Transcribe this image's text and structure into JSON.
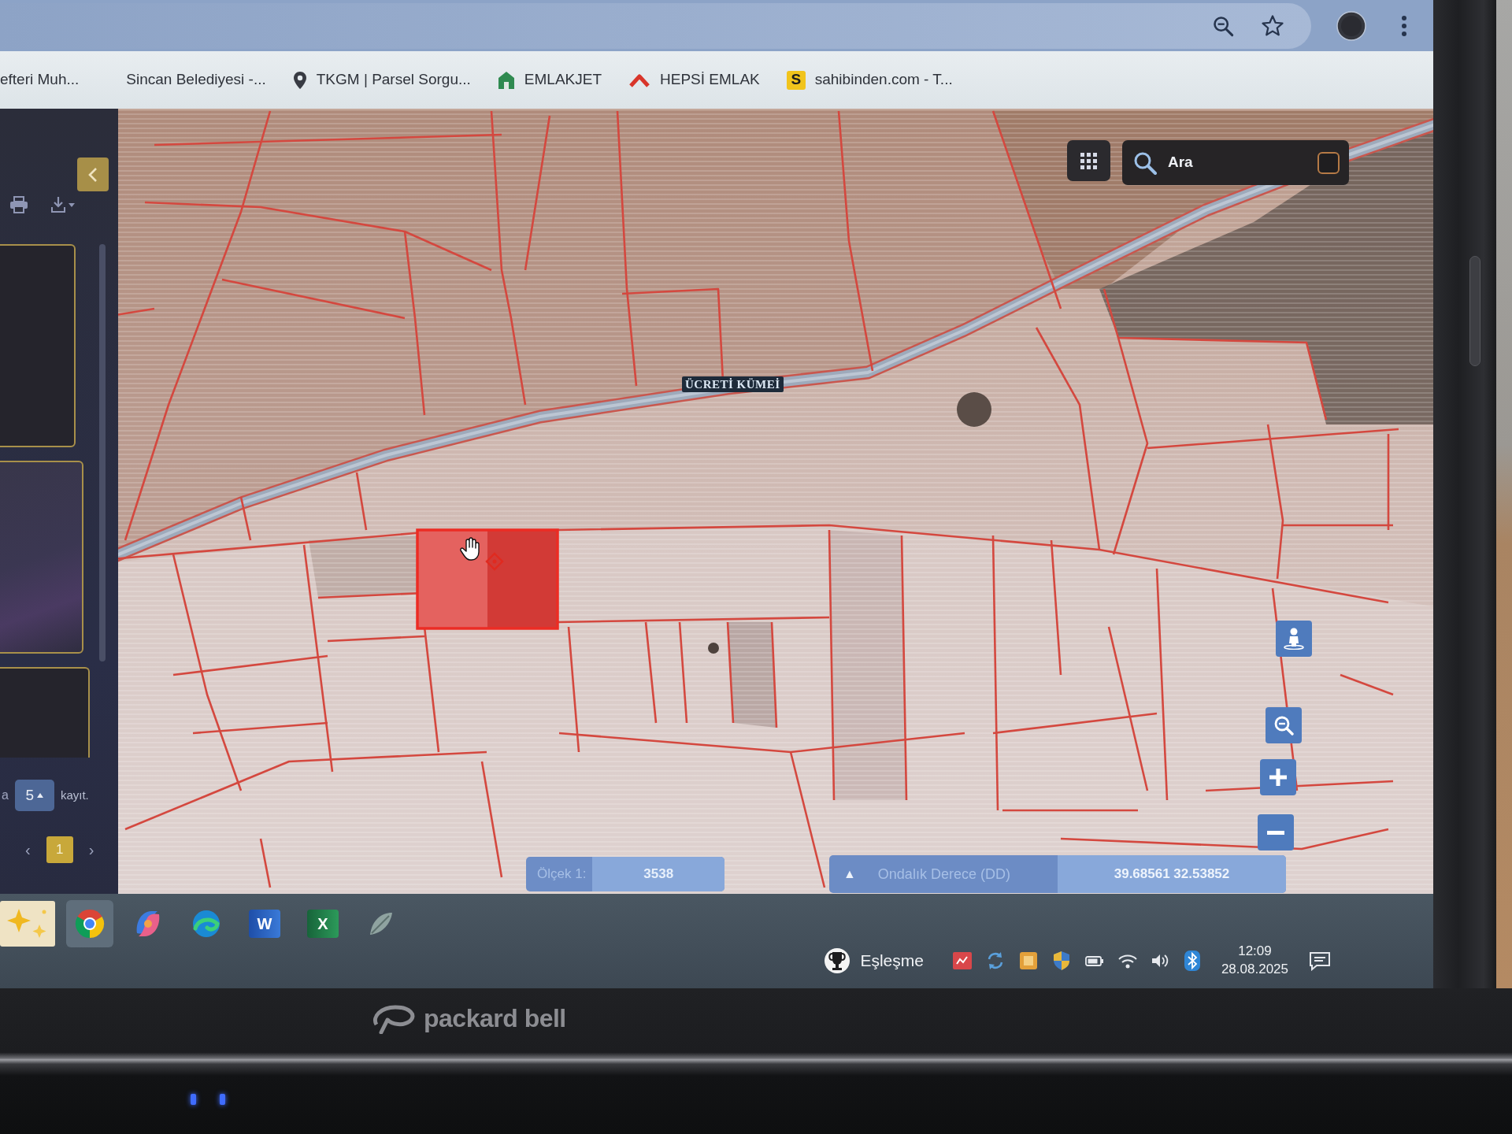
{
  "browser": {
    "bookmarks": [
      {
        "label": "efteri Muh...",
        "kind": "plain"
      },
      {
        "label": "Sincan Belediyesi -...",
        "kind": "plain"
      },
      {
        "label": "TKGM | Parsel Sorgu...",
        "kind": "pin"
      },
      {
        "label": "EMLAKJET",
        "kind": "house"
      },
      {
        "label": "HEPSİ EMLAK",
        "kind": "roof"
      },
      {
        "label": "sahibinden.com - T...",
        "kind": "letter",
        "icon_text": "S"
      }
    ]
  },
  "left_panel": {
    "cards": [
      {
        "kind": "dark"
      },
      {
        "kind": "image"
      },
      {
        "kind": "dark"
      }
    ],
    "page_size_prefix": "a",
    "page_size": "5",
    "page_size_suffix": "kayıt.",
    "prev": "‹",
    "pages": [
      {
        "label": "1",
        "selected": true
      }
    ],
    "next": "›"
  },
  "map": {
    "road_label": "ÜCRETİ KÜMEİ",
    "parcel_selected": true,
    "search": {
      "placeholder": "Ara"
    },
    "scale": {
      "label": "Ölçek 1:",
      "value": "3538"
    },
    "coordinates": {
      "toggle": "▲",
      "system": "Ondalık Derece (DD)",
      "value": "39.68561 32.53852"
    }
  },
  "taskbar": {
    "apps": [
      {
        "kind": "sparkle",
        "selected": false
      },
      {
        "kind": "tricolor",
        "selected": true
      },
      {
        "kind": "swirl",
        "selected": false
      },
      {
        "kind": "wave",
        "selected": false
      },
      {
        "kind": "word",
        "letter": "W",
        "selected": false
      },
      {
        "kind": "excel",
        "letter": "X",
        "selected": false
      },
      {
        "kind": "leaf",
        "selected": false
      }
    ],
    "widget": {
      "label": "Eşleşme"
    },
    "tray": [
      {
        "kind": "red-app"
      },
      {
        "kind": "sync"
      },
      {
        "kind": "orange-app"
      },
      {
        "kind": "shield"
      },
      {
        "kind": "battery"
      },
      {
        "kind": "wifi"
      },
      {
        "kind": "volume"
      },
      {
        "kind": "bluetooth"
      }
    ],
    "clock": {
      "time": "12:09",
      "date": "28.08.2025"
    }
  },
  "laptop": {
    "brand": "packard bell"
  }
}
